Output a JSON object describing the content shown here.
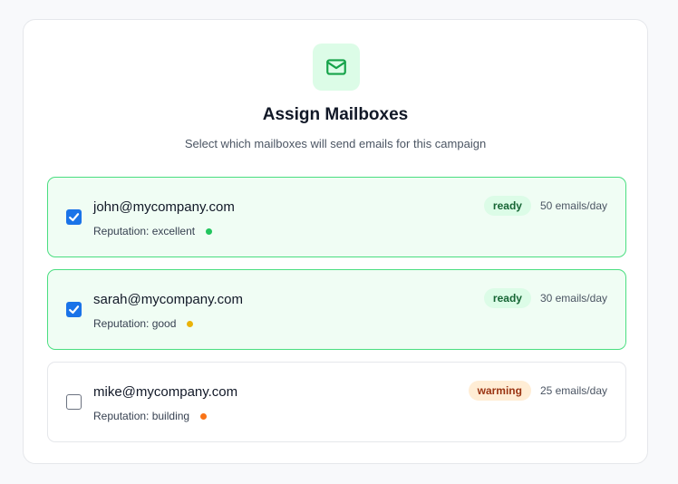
{
  "header": {
    "icon": "mail-icon",
    "title": "Assign Mailboxes",
    "subtitle": "Select which mailboxes will send emails for this campaign"
  },
  "mailboxes": [
    {
      "email": "john@mycompany.com",
      "selected": true,
      "status": "ready",
      "limit": "50 emails/day",
      "reputation": "Reputation: excellent",
      "reputation_color": "#22c55e"
    },
    {
      "email": "sarah@mycompany.com",
      "selected": true,
      "status": "ready",
      "limit": "30 emails/day",
      "reputation": "Reputation: good",
      "reputation_color": "#eab308"
    },
    {
      "email": "mike@mycompany.com",
      "selected": false,
      "status": "warming",
      "limit": "25 emails/day",
      "reputation": "Reputation: building",
      "reputation_color": "#f97316"
    }
  ],
  "colors": {
    "accent": "#16a34a",
    "checkbox": "#1a73e8",
    "selected_bg": "#f0fdf4",
    "selected_border": "#4ade80"
  }
}
